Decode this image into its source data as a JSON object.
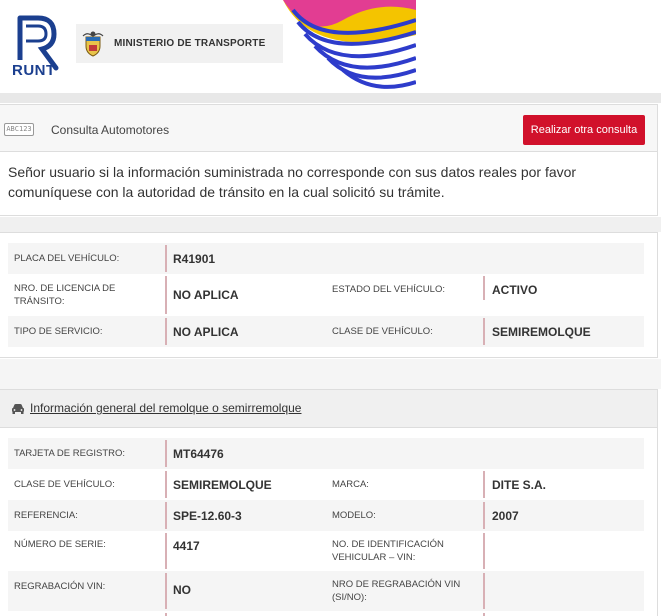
{
  "header": {
    "runt_label": "RUNT",
    "ministry_label": "MINISTERIO DE TRANSPORTE"
  },
  "consulta": {
    "plate_icon_text": "ABC123",
    "title": "Consulta Automotores",
    "button_label": "Realizar otra consulta"
  },
  "notice": {
    "text": "Señor usuario si la información suministrada no corresponde con sus datos reales por favor comuníquese con la autoridad de tránsito en la cual solicitó su trámite."
  },
  "vehiculo": {
    "placa_label": "PLACA DEL VEHÍCULO:",
    "placa_value": "R41901",
    "licencia_label": "NRO. DE LICENCIA DE TRÁNSITO:",
    "licencia_value": "NO APLICA",
    "estado_label": "ESTADO DEL VEHÍCULO:",
    "estado_value": "ACTIVO",
    "servicio_label": "TIPO DE SERVICIO:",
    "servicio_value": "NO APLICA",
    "clase_label": "CLASE DE VEHÍCULO:",
    "clase_value": "SEMIREMOLQUE"
  },
  "remolque": {
    "section_title": "Información general del remolque o semirremolque",
    "tarjeta_label": "TARJETA DE REGISTRO:",
    "tarjeta_value": "MT64476",
    "clase_label": "CLASE DE VEHÍCULO:",
    "clase_value": "SEMIREMOLQUE",
    "marca_label": "MARCA:",
    "marca_value": "DITE S.A.",
    "referencia_label": "REFERENCIA:",
    "referencia_value": "SPE-12.60-3",
    "modelo_label": "MODELO:",
    "modelo_value": "2007",
    "serie_label": "NÚMERO DE SERIE:",
    "serie_value": "4417",
    "vin_label": "NO. DE IDENTIFICACIÓN VEHICULAR – VIN:",
    "vin_value": "",
    "regrabacion_label": "REGRABACIÓN VIN:",
    "regrabacion_value": "NO",
    "nro_regrabacion_label": "NRO DE REGRABACIÓN VIN (SI/NO):",
    "nro_regrabacion_value": ""
  },
  "colors": {
    "accent_red": "#d1112b",
    "runt_blue": "#1b3f8f"
  }
}
